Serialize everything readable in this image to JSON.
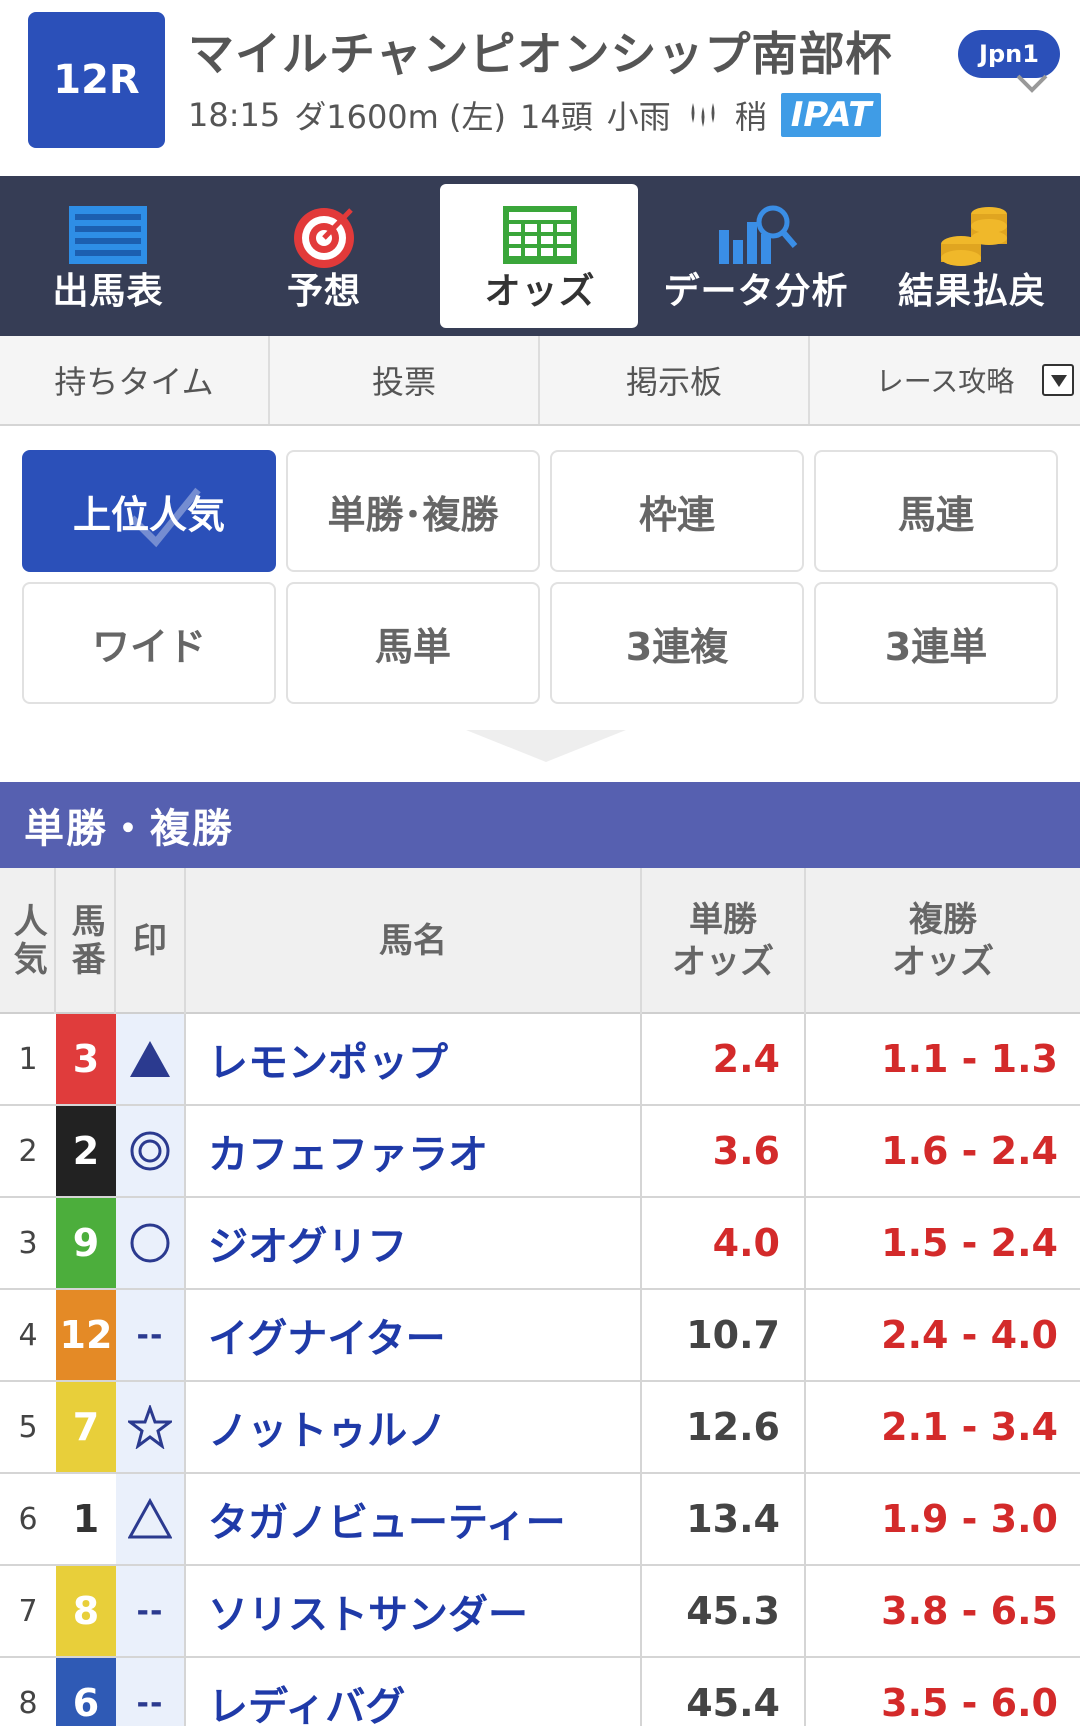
{
  "header": {
    "race_no": "12R",
    "title": "マイルチャンピオンシップ南部杯",
    "time": "18:15",
    "course": "ダ1600m (左)",
    "runners": "14頭",
    "weather": "小雨",
    "track_condition": "稍",
    "ipat": "IPAT",
    "grade": "Jpn1"
  },
  "main_nav": [
    {
      "label": "出馬表",
      "icon": "race-card-icon"
    },
    {
      "label": "予想",
      "icon": "target-icon"
    },
    {
      "label": "オッズ",
      "icon": "odds-table-icon",
      "active": true
    },
    {
      "label": "データ分析",
      "icon": "data-analysis-icon"
    },
    {
      "label": "結果払戻",
      "icon": "coins-icon"
    }
  ],
  "sub_nav": [
    {
      "label": "持ちタイム"
    },
    {
      "label": "投票"
    },
    {
      "label": "掲示板"
    },
    {
      "label": "レース攻略"
    }
  ],
  "bet_types": [
    {
      "label": "上位人気",
      "active": true
    },
    {
      "label": "単勝･複勝"
    },
    {
      "label": "枠連"
    },
    {
      "label": "馬連"
    },
    {
      "label": "ワイド"
    },
    {
      "label": "馬単"
    },
    {
      "label": "3連複"
    },
    {
      "label": "3連単"
    }
  ],
  "section_title": "単勝・複勝",
  "table": {
    "headers": {
      "rank": "人気",
      "number": "馬番",
      "mark": "印",
      "name": "馬名",
      "win": "単勝オッズ",
      "place": "複勝オッズ"
    },
    "rows": [
      {
        "rank": "1",
        "number": "3",
        "frame_color": "#e03c3c",
        "num_color": "#ffffff",
        "mark": "filled-triangle",
        "name": "レモンポップ",
        "win": "2.4",
        "win_hot": true,
        "place": "1.1 - 1.3"
      },
      {
        "rank": "2",
        "number": "2",
        "frame_color": "#222222",
        "num_color": "#ffffff",
        "mark": "double-circle",
        "name": "カフェファラオ",
        "win": "3.6",
        "win_hot": true,
        "place": "1.6 - 2.4"
      },
      {
        "rank": "3",
        "number": "9",
        "frame_color": "#4cae3c",
        "num_color": "#ffffff",
        "mark": "circle",
        "name": "ジオグリフ",
        "win": "4.0",
        "win_hot": true,
        "place": "1.5 - 2.4"
      },
      {
        "rank": "4",
        "number": "12",
        "frame_color": "#e48a26",
        "num_color": "#ffffff",
        "mark": "--",
        "name": "イグナイター",
        "win": "10.7",
        "win_hot": false,
        "place": "2.4 - 4.0"
      },
      {
        "rank": "5",
        "number": "7",
        "frame_color": "#e8cf3a",
        "num_color": "#ffffff",
        "mark": "star",
        "name": "ノットゥルノ",
        "win": "12.6",
        "win_hot": false,
        "place": "2.1 - 3.4"
      },
      {
        "rank": "6",
        "number": "1",
        "frame_color": "#ffffff",
        "num_color": "#333333",
        "mark": "triangle",
        "name": "タガノビューティー",
        "win": "13.4",
        "win_hot": false,
        "place": "1.9 - 3.0"
      },
      {
        "rank": "7",
        "number": "8",
        "frame_color": "#e8cf3a",
        "num_color": "#ffffff",
        "mark": "--",
        "name": "ソリストサンダー",
        "win": "45.3",
        "win_hot": false,
        "place": "3.8 - 6.5"
      },
      {
        "rank": "8",
        "number": "6",
        "frame_color": "#2f5ab5",
        "num_color": "#ffffff",
        "mark": "--",
        "name": "レディバグ",
        "win": "45.4",
        "win_hot": false,
        "place": "3.5 - 6.0"
      }
    ]
  },
  "colors": {
    "brand_blue": "#2b50b9",
    "nav_dark": "#363d55",
    "section_purple": "#5660b0",
    "odds_red": "#d32a2a",
    "name_blue": "#1f3aa8"
  }
}
